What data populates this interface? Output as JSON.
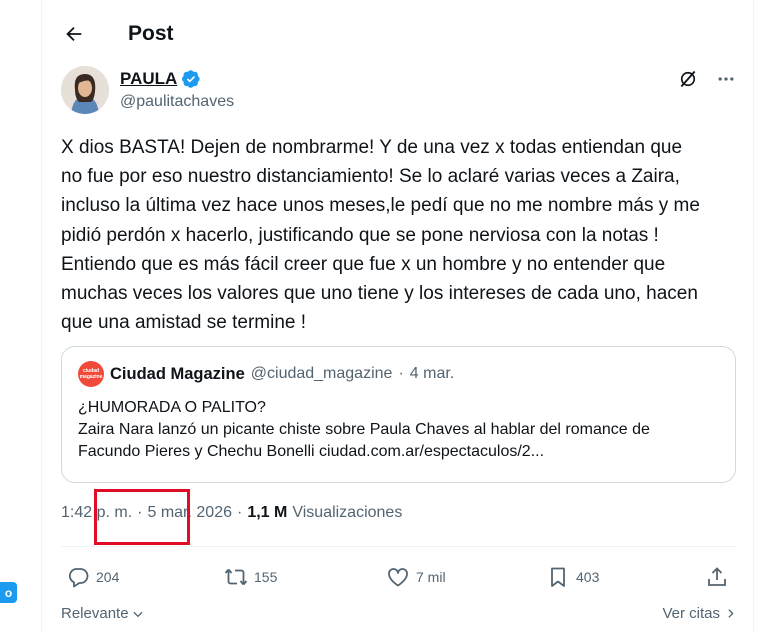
{
  "header": {
    "title": "Post"
  },
  "left_badge": {
    "text": "o"
  },
  "author": {
    "name": "PAULA",
    "handle": "@paulitachaves",
    "verified": true
  },
  "tweet": {
    "text": "X dios BASTA! Dejen de nombrarme! Y de una vez x todas entiendan que\nno fue por eso nuestro distanciamiento! Se lo aclaré varias veces a Zaira,\nincluso la última vez hace unos meses,le pedí que no me nombre más y me\npidió perdón x hacerlo, justificando que se pone nerviosa con la notas !\nEntiendo que es más fácil creer que fue x un hombre y no entender que\nmuchas veces los valores que uno tiene  y los intereses de cada uno, hacen\nque una amistad se termine !"
  },
  "quote": {
    "avatar_text": "ciudad magazine",
    "name": "Ciudad Magazine",
    "handle": "@ciudad_magazine",
    "sep": "·",
    "date": "4 mar.",
    "line1": "¿HUMORADA O PALITO?",
    "line2": "Zaira Nara lanzó un picante chiste sobre Paula Chaves al hablar del romance de",
    "line3": "Facundo Pieres y Chechu Bonelli ciudad.com.ar/espectaculos/2..."
  },
  "meta": {
    "time": "1:42 p. m.",
    "sep1": "·",
    "date": "5 mar. 2026",
    "sep2": "·",
    "views": "1,1 M",
    "views_label": "Visualizaciones"
  },
  "actions": {
    "replies": "204",
    "reposts": "155",
    "likes": "7 mil",
    "bookmarks": "403"
  },
  "footer": {
    "sort_label": "Relevante",
    "citas_label": "Ver citas"
  },
  "colors": {
    "accent": "#1d9bf0",
    "highlight": "#e10d27",
    "muted": "#536471",
    "text": "#0f1419"
  }
}
